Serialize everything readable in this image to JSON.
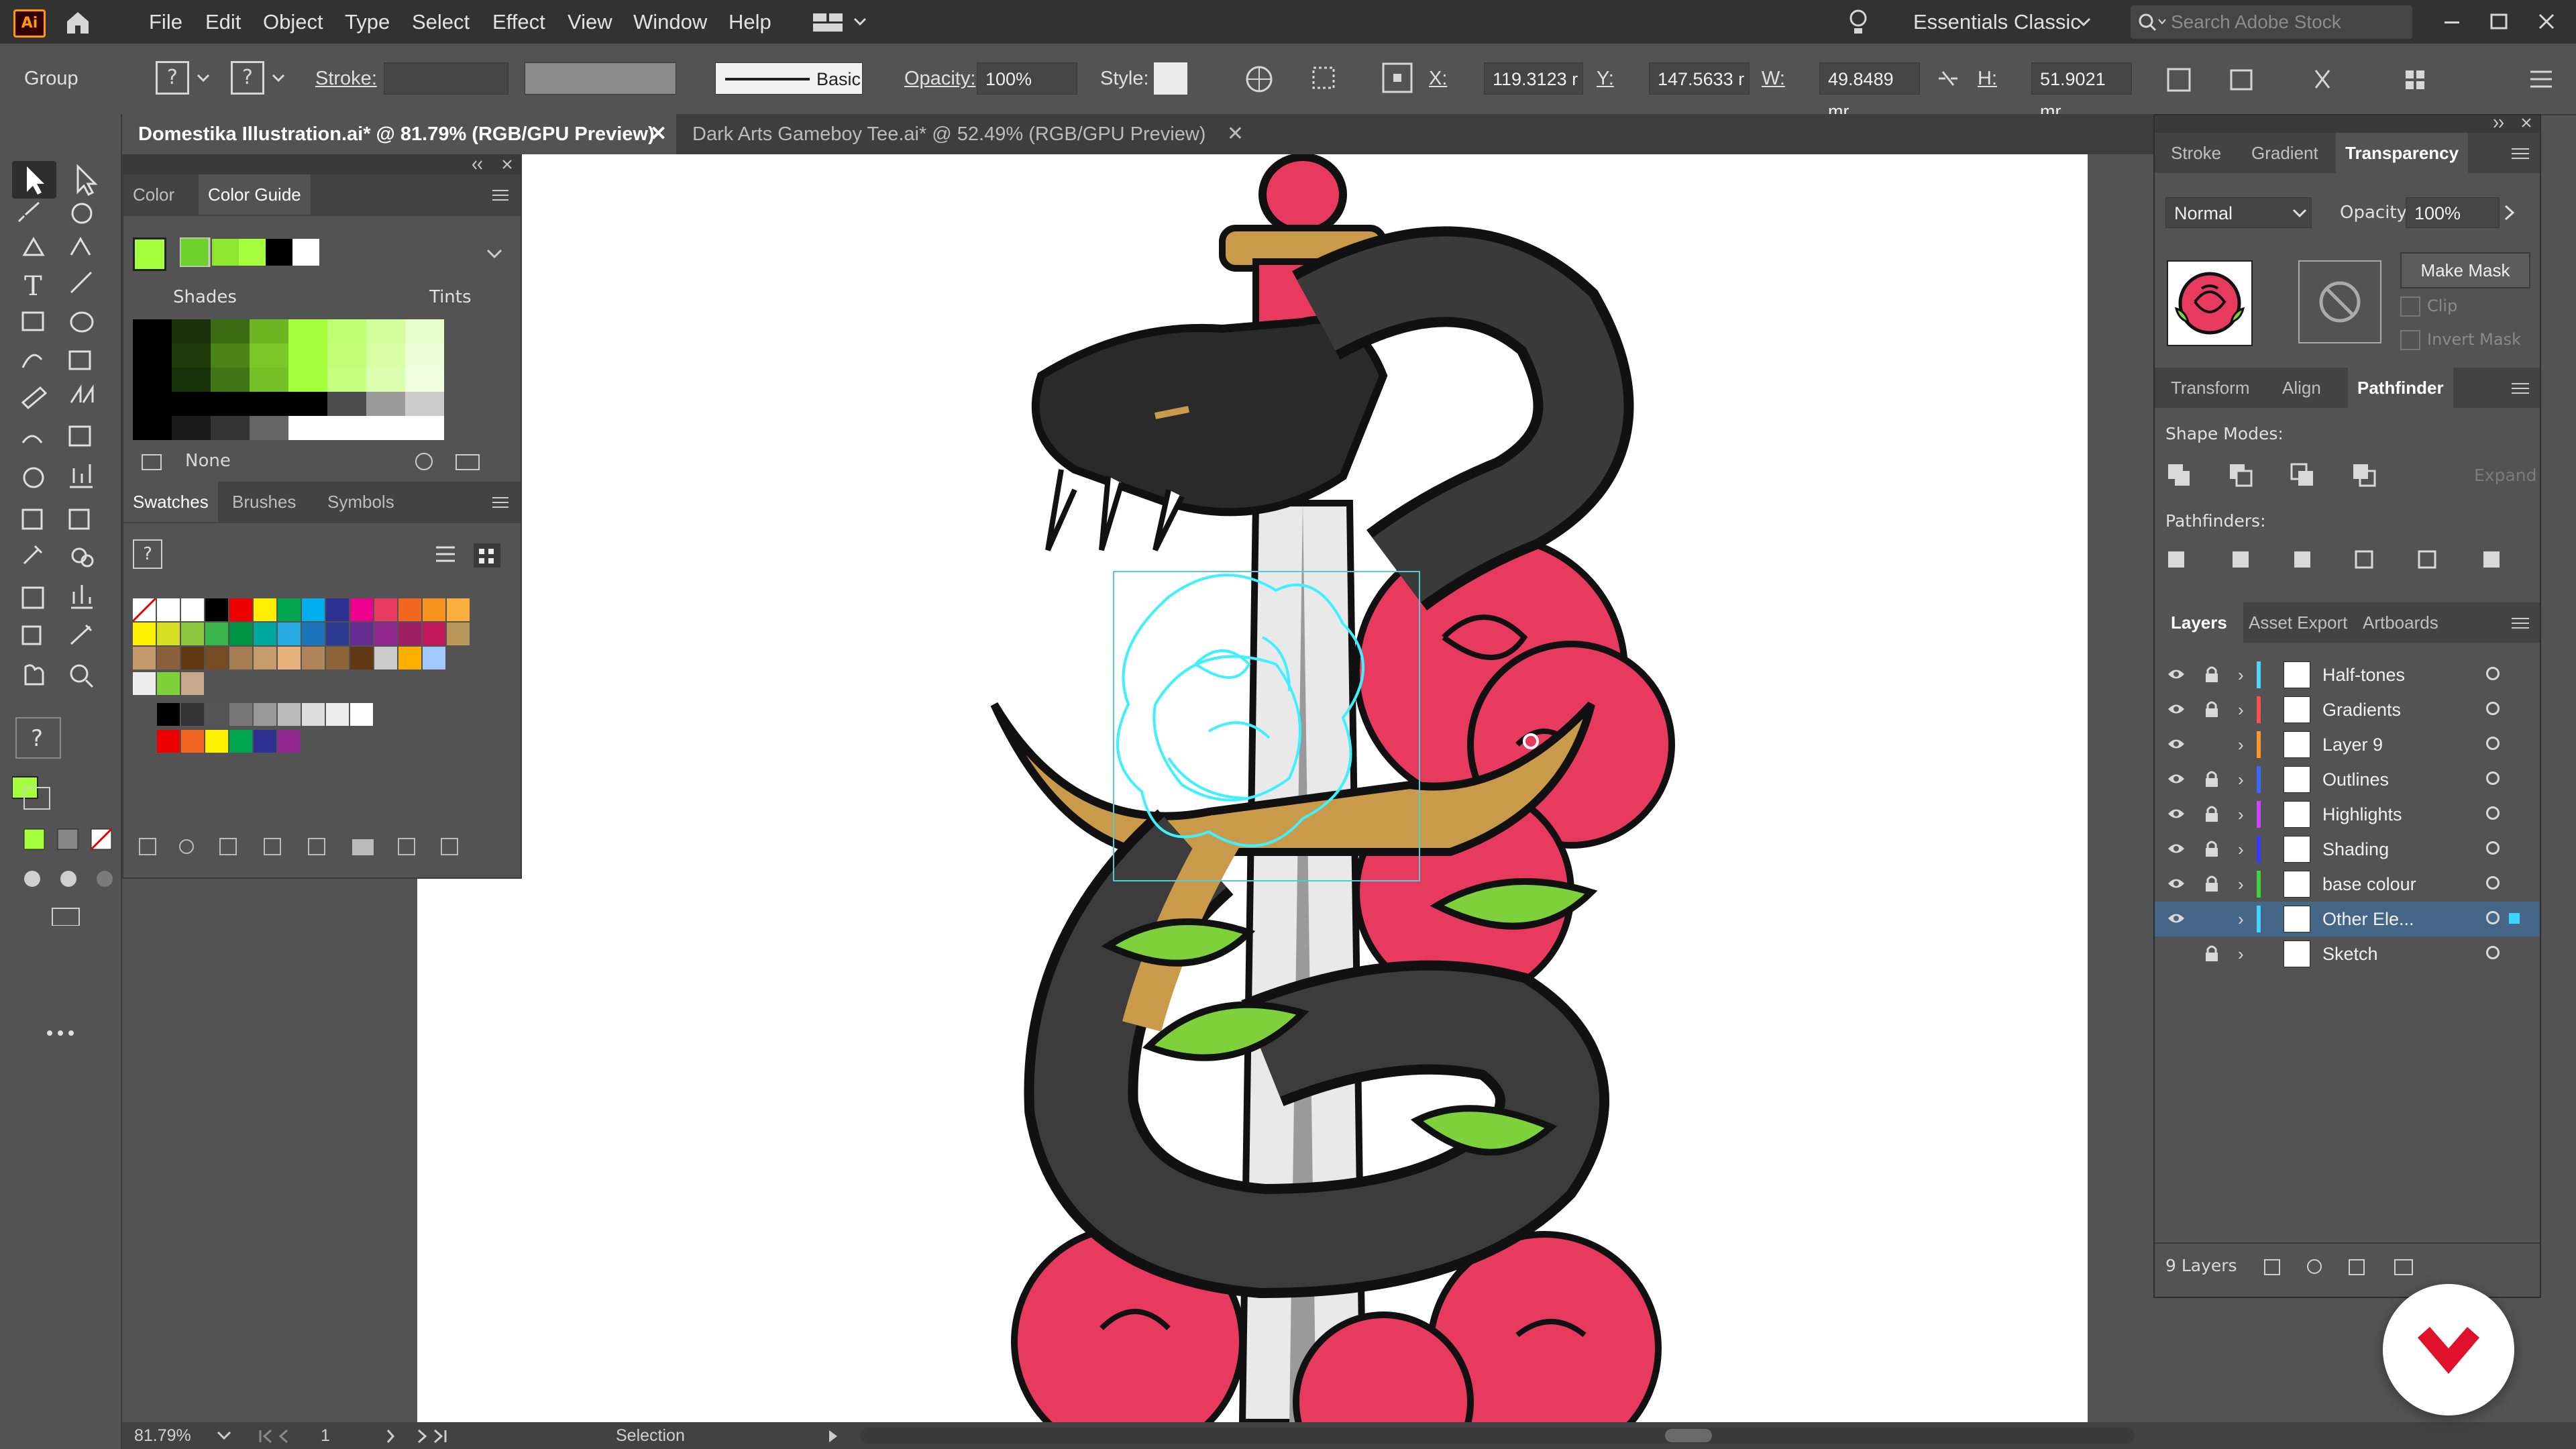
{
  "app": {
    "logo": "Ai"
  },
  "menu": [
    "File",
    "Edit",
    "Object",
    "Type",
    "Select",
    "Effect",
    "View",
    "Window",
    "Help"
  ],
  "workspace": "Essentials Classic",
  "stock_search": {
    "placeholder": "Search Adobe Stock"
  },
  "control": {
    "selection_type": "Group",
    "stroke_label": "Stroke:",
    "stroke_profile": "Basic",
    "opacity_label": "Opacity:",
    "opacity_value": "100%",
    "style_label": "Style:",
    "x_label": "X:",
    "x_value": "119.3123 r",
    "y_label": "Y:",
    "y_value": "147.5633 r",
    "w_label": "W:",
    "w_value": "49.8489 mr",
    "h_label": "H:",
    "h_value": "51.9021 mr"
  },
  "documents": [
    {
      "title": "Domestika Illustration.ai* @ 81.79% (RGB/GPU Preview)",
      "active": true
    },
    {
      "title": "Dark Arts Gameboy Tee.ai* @ 52.49% (RGB/GPU Preview)",
      "active": false
    }
  ],
  "left_panel": {
    "top_tabs": [
      "Color",
      "Color Guide"
    ],
    "shades_label": "Shades",
    "tints_label": "Tints",
    "none_label": "None",
    "bottom_tabs": [
      "Swatches",
      "Brushes",
      "Symbols"
    ]
  },
  "right_panel": {
    "top_tabs": [
      "Stroke",
      "Gradient",
      "Transparency"
    ],
    "blend_mode": "Normal",
    "opacity_label": "Opacity:",
    "opacity_value": "100%",
    "make_mask": "Make Mask",
    "clip_label": "Clip",
    "invert_mask_label": "Invert Mask",
    "mid_tabs": [
      "Transform",
      "Align",
      "Pathfinder"
    ],
    "shape_modes_label": "Shape Modes:",
    "expand_label": "Expand",
    "pathfinders_label": "Pathfinders:",
    "layer_tabs": [
      "Layers",
      "Asset Export",
      "Artboards"
    ],
    "layers": [
      {
        "name": "Half-tones",
        "color": "#4fd3ff",
        "visible": true,
        "locked": true
      },
      {
        "name": "Gradients",
        "color": "#ff4f4f",
        "visible": true,
        "locked": true
      },
      {
        "name": "Layer 9",
        "color": "#ff9a2a",
        "visible": true,
        "locked": false
      },
      {
        "name": "Outlines",
        "color": "#3b68ff",
        "visible": true,
        "locked": true
      },
      {
        "name": "Highlights",
        "color": "#cc44ff",
        "visible": true,
        "locked": true
      },
      {
        "name": "Shading",
        "color": "#3b3bff",
        "visible": true,
        "locked": true
      },
      {
        "name": "base colour",
        "color": "#41d041",
        "visible": true,
        "locked": true
      },
      {
        "name": "Other Ele...",
        "color": "#3fd3ff",
        "visible": true,
        "locked": false,
        "selected": true
      },
      {
        "name": "Sketch",
        "color": "#d0d0d0",
        "visible": false,
        "locked": true
      }
    ],
    "layer_count": "9 Layers"
  },
  "status": {
    "zoom": "81.79%",
    "artboard_number": "1",
    "tool_status": "Selection"
  },
  "colors": {
    "accent_green": "#a6ff3d",
    "rose": "#e8395f",
    "gold": "#c89a4a",
    "selection_cyan": "#3ff0ff"
  }
}
